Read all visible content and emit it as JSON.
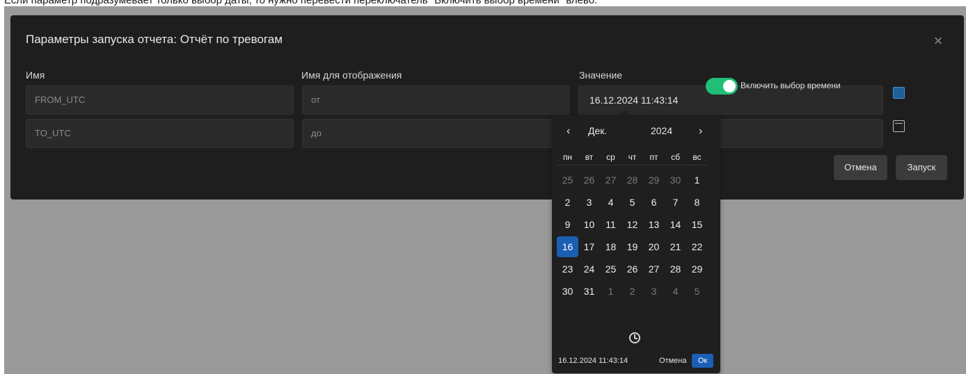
{
  "instruction": "Если параметр подразумевает только выбор даты, то нужно перевести переключатель \"Включить выбор времени\" влево.",
  "dialog": {
    "title": "Параметры запуска отчета: Отчёт по тревогам",
    "close_label": "×",
    "columns": {
      "name": "Имя",
      "display_name": "Имя для отображения",
      "value": "Значение"
    },
    "rows": [
      {
        "name": "FROM_UTC",
        "display_name": "от",
        "value": "16.12.2024 11:43:14"
      },
      {
        "name": "TO_UTC",
        "display_name": "до",
        "value": ""
      }
    ],
    "toggle_label": "Включить выбор времени",
    "toggle_on": true,
    "cancel_label": "Отмена",
    "run_label": "Запуск"
  },
  "datepicker": {
    "prev": "‹",
    "next": "›",
    "month": "Дек.",
    "year": "2024",
    "weekdays": [
      "пн",
      "вт",
      "ср",
      "чт",
      "пт",
      "сб",
      "вс"
    ],
    "weeks": [
      [
        {
          "d": "25",
          "m": true
        },
        {
          "d": "26",
          "m": true
        },
        {
          "d": "27",
          "m": true
        },
        {
          "d": "28",
          "m": true
        },
        {
          "d": "29",
          "m": true
        },
        {
          "d": "30",
          "m": true
        },
        {
          "d": "1",
          "m": false
        }
      ],
      [
        {
          "d": "2",
          "m": false
        },
        {
          "d": "3",
          "m": false
        },
        {
          "d": "4",
          "m": false
        },
        {
          "d": "5",
          "m": false
        },
        {
          "d": "6",
          "m": false
        },
        {
          "d": "7",
          "m": false
        },
        {
          "d": "8",
          "m": false
        }
      ],
      [
        {
          "d": "9",
          "m": false
        },
        {
          "d": "10",
          "m": false
        },
        {
          "d": "11",
          "m": false
        },
        {
          "d": "12",
          "m": false
        },
        {
          "d": "13",
          "m": false
        },
        {
          "d": "14",
          "m": false
        },
        {
          "d": "15",
          "m": false
        }
      ],
      [
        {
          "d": "16",
          "m": false,
          "sel": true
        },
        {
          "d": "17",
          "m": false
        },
        {
          "d": "18",
          "m": false
        },
        {
          "d": "19",
          "m": false
        },
        {
          "d": "20",
          "m": false
        },
        {
          "d": "21",
          "m": false
        },
        {
          "d": "22",
          "m": false
        }
      ],
      [
        {
          "d": "23",
          "m": false
        },
        {
          "d": "24",
          "m": false
        },
        {
          "d": "25",
          "m": false
        },
        {
          "d": "26",
          "m": false
        },
        {
          "d": "27",
          "m": false
        },
        {
          "d": "28",
          "m": false
        },
        {
          "d": "29",
          "m": false
        }
      ],
      [
        {
          "d": "30",
          "m": false
        },
        {
          "d": "31",
          "m": false
        },
        {
          "d": "1",
          "m": true
        },
        {
          "d": "2",
          "m": true
        },
        {
          "d": "3",
          "m": true
        },
        {
          "d": "4",
          "m": true
        },
        {
          "d": "5",
          "m": true
        }
      ]
    ],
    "selected_datetime": "16.12.2024 11:43:14",
    "cancel_label": "Отмена",
    "ok_label": "Ок",
    "clock_icon": "clock-icon"
  },
  "colors": {
    "accent": "#1a5fb4",
    "toggle_on": "#1fbf77",
    "dialog_bg": "#1e1e1e",
    "overlay": "#9a9a9a"
  }
}
